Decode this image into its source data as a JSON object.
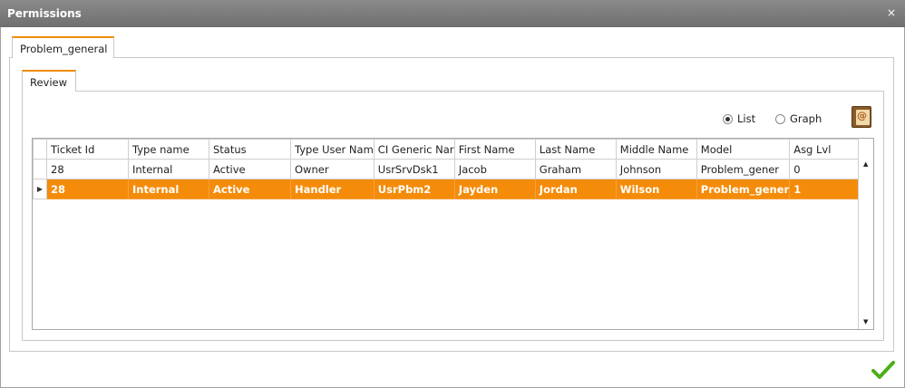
{
  "window": {
    "title": "Permissions",
    "close_icon": "×"
  },
  "tabs": {
    "outer": "Problem_general",
    "inner": "Review"
  },
  "view": {
    "list_label": "List",
    "graph_label": "Graph",
    "selected": "List"
  },
  "grid": {
    "columns": [
      "Ticket Id",
      "Type name",
      "Status",
      "Type User Nam",
      "CI Generic Nar",
      "First Name",
      "Last Name",
      "Middle Name",
      "Model",
      "Asg Lvl"
    ],
    "rows": [
      [
        "28",
        "Internal",
        "Active",
        "Owner",
        "UsrSrvDsk1",
        "Jacob",
        "Graham",
        "Johnson",
        "Problem_gener",
        "0"
      ],
      [
        "28",
        "Internal",
        "Active",
        "Handler",
        "UsrPbm2",
        "Jayden",
        "Jordan",
        "Wilson",
        "Problem_gener",
        "1"
      ]
    ],
    "selected_row": 1,
    "row_indicator": "▶"
  },
  "colors": {
    "accent": "#f08c00",
    "selected_row": "#f48c0a",
    "ok": "#4caf1a"
  },
  "icons": {
    "address_book": "address-book-icon",
    "ok": "checkmark-icon"
  }
}
